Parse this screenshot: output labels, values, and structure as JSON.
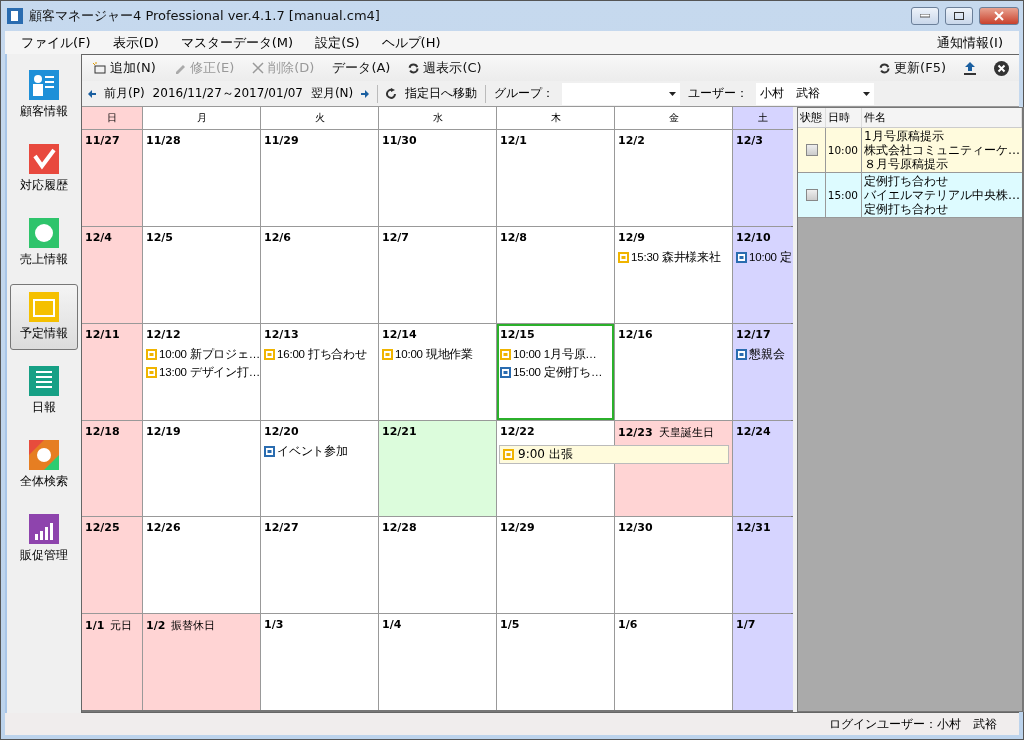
{
  "window": {
    "title": "顧客マネージャー4 Professional ver.4.1.7 [manual.cm4]"
  },
  "menu": [
    "ファイル(F)",
    "表示(D)",
    "マスターデータ(M)",
    "設定(S)",
    "ヘルプ(H)"
  ],
  "menu_right": "通知情報(I)",
  "sidebar": [
    {
      "label": "顧客情報",
      "kind": "customer",
      "selected": false
    },
    {
      "label": "対応履歴",
      "kind": "history",
      "selected": false
    },
    {
      "label": "売上情報",
      "kind": "sales",
      "selected": false
    },
    {
      "label": "予定情報",
      "kind": "schedule",
      "selected": true
    },
    {
      "label": "日報",
      "kind": "report",
      "selected": false
    },
    {
      "label": "全体検索",
      "kind": "search",
      "selected": false
    },
    {
      "label": "販促管理",
      "kind": "promo",
      "selected": false
    }
  ],
  "toolbar": [
    {
      "label": "追加(N)",
      "kind": "add",
      "disabled": false
    },
    {
      "label": "修正(E)",
      "kind": "edit",
      "disabled": true
    },
    {
      "label": "削除(D)",
      "kind": "delete",
      "disabled": true
    },
    {
      "label": "データ(A)",
      "kind": "plain",
      "disabled": false
    },
    {
      "label": "週表示(C)",
      "kind": "refresh",
      "disabled": false
    }
  ],
  "toolbar_right": {
    "refresh": "更新(F5)"
  },
  "nav": {
    "prev": "前月(P)",
    "range": "2016/11/27～2017/01/07",
    "next": "翌月(N)",
    "goto": "指定日へ移動",
    "group_label": "グループ：",
    "user_label": "ユーザー：",
    "user_value": "小村　武裕"
  },
  "calendar": {
    "weekdays": [
      {
        "label": "日",
        "kind": "sun"
      },
      {
        "label": "月",
        "kind": "normal"
      },
      {
        "label": "火",
        "kind": "normal"
      },
      {
        "label": "水",
        "kind": "normal"
      },
      {
        "label": "木",
        "kind": "normal"
      },
      {
        "label": "金",
        "kind": "normal"
      },
      {
        "label": "土",
        "kind": "sat"
      }
    ],
    "weeks": [
      [
        {
          "date": "11/27",
          "kind": "sun",
          "selected": false
        },
        {
          "date": "11/28",
          "kind": "normal",
          "selected": false
        },
        {
          "date": "11/29",
          "kind": "normal",
          "selected": false
        },
        {
          "date": "11/30",
          "kind": "normal",
          "selected": false
        },
        {
          "date": "12/1",
          "kind": "normal",
          "selected": false
        },
        {
          "date": "12/2",
          "kind": "normal",
          "selected": false
        },
        {
          "date": "12/3",
          "kind": "sat",
          "selected": false
        }
      ],
      [
        {
          "date": "12/4",
          "kind": "sun",
          "selected": false
        },
        {
          "date": "12/5",
          "kind": "normal",
          "selected": false
        },
        {
          "date": "12/6",
          "kind": "normal",
          "selected": false
        },
        {
          "date": "12/7",
          "kind": "normal",
          "selected": false
        },
        {
          "date": "12/8",
          "kind": "normal",
          "selected": false
        },
        {
          "date": "12/9",
          "kind": "normal",
          "selected": false,
          "events": [
            {
              "time": "15:30",
              "title": "森井様来社",
              "color": "#f0b400"
            }
          ]
        },
        {
          "date": "12/10",
          "kind": "sat",
          "selected": false,
          "events": [
            {
              "time": "10:00",
              "title": "定",
              "color": "#2a6cb0"
            }
          ]
        }
      ],
      [
        {
          "date": "12/11",
          "kind": "sun",
          "selected": false
        },
        {
          "date": "12/12",
          "kind": "normal",
          "selected": false,
          "events": [
            {
              "time": "10:00",
              "title": "新プロジェ…",
              "color": "#f0b400"
            },
            {
              "time": "13:00",
              "title": "デザイン打…",
              "color": "#f0b400"
            }
          ]
        },
        {
          "date": "12/13",
          "kind": "normal",
          "selected": false,
          "events": [
            {
              "time": "16:00",
              "title": "打ち合わせ",
              "color": "#f0b400"
            }
          ]
        },
        {
          "date": "12/14",
          "kind": "normal",
          "selected": false,
          "events": [
            {
              "time": "10:00",
              "title": "現地作業",
              "color": "#f0b400"
            }
          ]
        },
        {
          "date": "12/15",
          "kind": "normal",
          "selected": true,
          "events": [
            {
              "time": "10:00",
              "title": "1月号原…",
              "color": "#f0b400"
            },
            {
              "time": "15:00",
              "title": "定例打ち…",
              "color": "#2a6cb0"
            }
          ]
        },
        {
          "date": "12/16",
          "kind": "normal",
          "selected": false
        },
        {
          "date": "12/17",
          "kind": "sat",
          "selected": false,
          "events": [
            {
              "title": "懇親会",
              "color": "#2a6cb0"
            }
          ]
        }
      ],
      [
        {
          "date": "12/18",
          "kind": "sun",
          "selected": false
        },
        {
          "date": "12/19",
          "kind": "normal",
          "selected": false
        },
        {
          "date": "12/20",
          "kind": "normal",
          "selected": false,
          "events": [
            {
              "title": "イベント参加",
              "color": "#2a6cb0"
            }
          ]
        },
        {
          "date": "12/21",
          "kind": "today",
          "selected": false
        },
        {
          "date": "12/22",
          "kind": "normal",
          "selected": false,
          "events": [
            {
              "time": "9:00",
              "title": "出張",
              "color": "#f0b400",
              "kind": "span"
            }
          ]
        },
        {
          "date": "12/23",
          "kind": "holiday",
          "holiday": "天皇誕生日",
          "selected": false
        },
        {
          "date": "12/24",
          "kind": "sat",
          "selected": false
        }
      ],
      [
        {
          "date": "12/25",
          "kind": "sun",
          "selected": false
        },
        {
          "date": "12/26",
          "kind": "normal",
          "selected": false
        },
        {
          "date": "12/27",
          "kind": "normal",
          "selected": false
        },
        {
          "date": "12/28",
          "kind": "normal",
          "selected": false
        },
        {
          "date": "12/29",
          "kind": "normal",
          "selected": false
        },
        {
          "date": "12/30",
          "kind": "normal",
          "selected": false
        },
        {
          "date": "12/31",
          "kind": "sat",
          "selected": false
        }
      ],
      [
        {
          "date": "1/1",
          "kind": "sun",
          "holiday": "元日",
          "selected": false
        },
        {
          "date": "1/2",
          "kind": "holiday",
          "holiday": "振替休日",
          "selected": false
        },
        {
          "date": "1/3",
          "kind": "normal",
          "selected": false
        },
        {
          "date": "1/4",
          "kind": "normal",
          "selected": false
        },
        {
          "date": "1/5",
          "kind": "normal",
          "selected": false
        },
        {
          "date": "1/6",
          "kind": "normal",
          "selected": false
        },
        {
          "date": "1/7",
          "kind": "sat",
          "selected": false
        }
      ]
    ]
  },
  "day_list": {
    "columns": [
      "状態",
      "日時",
      "件名"
    ],
    "rows": [
      {
        "checked": false,
        "time": "10:00",
        "lines": [
          "1月号原稿提示",
          "株式会社コミュニティーケ…",
          "８月号原稿提示"
        ],
        "color": "#fffbdd"
      },
      {
        "checked": false,
        "time": "15:00",
        "lines": [
          "定例打ち合わせ",
          "バイエルマテリアル中央株…",
          "定例打ち合わせ"
        ],
        "color": "#ddfbff"
      }
    ]
  },
  "status_bar": "ログインユーザー：小村　武裕"
}
